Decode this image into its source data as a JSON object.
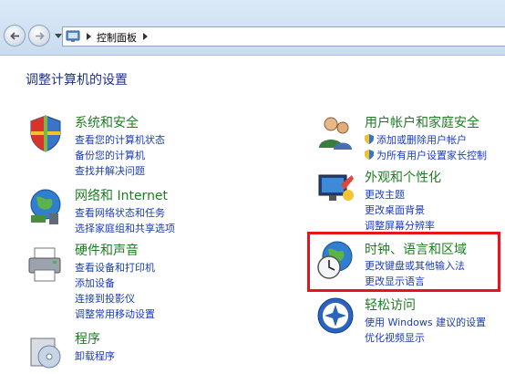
{
  "address_bar": {
    "crumb": "控制面板",
    "back_icon": "back-arrow-icon",
    "forward_icon": "forward-arrow-icon"
  },
  "page_title": "调整计算机的设置",
  "left_categories": [
    {
      "title": "系统和安全",
      "icon": "shield-flag-icon",
      "links": [
        "查看您的计算机状态",
        "备份您的计算机",
        "查找并解决问题"
      ]
    },
    {
      "title": "网络和 Internet",
      "icon": "globe-network-icon",
      "links": [
        "查看网络状态和任务",
        "选择家庭组和共享选项"
      ]
    },
    {
      "title": "硬件和声音",
      "icon": "printer-icon",
      "links": [
        "查看设备和打印机",
        "添加设备",
        "连接到投影仪",
        "调整常用移动设置"
      ]
    },
    {
      "title": "程序",
      "icon": "programs-icon",
      "links": [
        "卸载程序"
      ]
    }
  ],
  "right_categories": [
    {
      "title": "用户帐户和家庭安全",
      "icon": "users-icon",
      "links": [
        "添加或删除用户帐户",
        "为所有用户设置家长控制"
      ]
    },
    {
      "title": "外观和个性化",
      "icon": "appearance-icon",
      "links": [
        "更改主题",
        "更改桌面背景",
        "调整屏幕分辨率"
      ]
    },
    {
      "title": "时钟、语言和区域",
      "icon": "clock-globe-icon",
      "links": [
        "更改键盘或其他输入法",
        "更改显示语言"
      ]
    },
    {
      "title": "轻松访问",
      "icon": "ease-of-access-icon",
      "links": [
        "使用 Windows 建议的设置",
        "优化视频显示"
      ]
    }
  ],
  "colors": {
    "title_green": "#1e7d22",
    "link_blue": "#1a3cb8",
    "heading_blue": "#1e3287",
    "highlight_red": "#e8141c"
  }
}
